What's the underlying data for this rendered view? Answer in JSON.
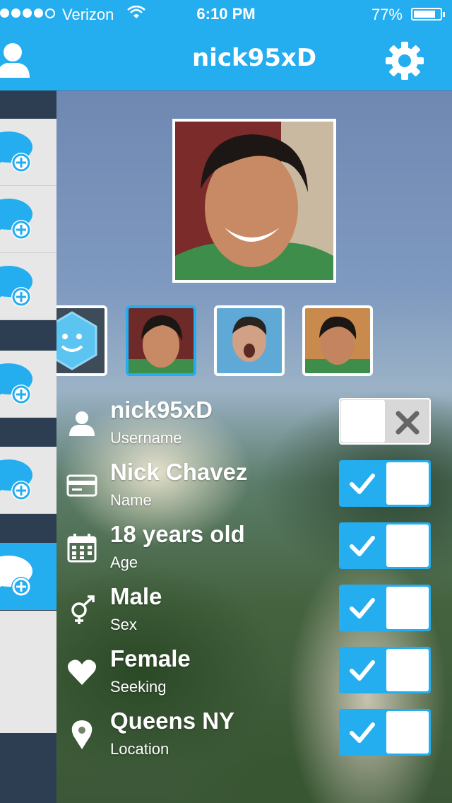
{
  "status_bar": {
    "carrier": "Verizon",
    "time": "6:10 PM",
    "battery": "77%",
    "battery_level": 0.77
  },
  "header": {
    "title": "nick95xD"
  },
  "sidebar": {
    "items": [
      {
        "name": "chat-1"
      },
      {
        "name": "chat-2"
      },
      {
        "name": "chat-3"
      },
      {
        "name": "chat-4"
      },
      {
        "name": "chat-5"
      },
      {
        "name": "chat-6"
      }
    ]
  },
  "profile": {
    "fields": [
      {
        "value": "nick95xD",
        "label": "Username",
        "icon": "person-icon",
        "shared": false
      },
      {
        "value": "Nick Chavez",
        "label": "Name",
        "icon": "card-icon",
        "shared": true
      },
      {
        "value": "18 years old",
        "label": "Age",
        "icon": "calendar-icon",
        "shared": true
      },
      {
        "value": "Male",
        "label": "Sex",
        "icon": "gender-icon",
        "shared": true
      },
      {
        "value": "Female",
        "label": "Seeking",
        "icon": "heart-icon",
        "shared": true
      },
      {
        "value": "Queens NY",
        "label": "Location",
        "icon": "location-pin-icon",
        "shared": true
      }
    ]
  },
  "colors": {
    "accent": "#24adef",
    "sidebar_dark": "#2e3e52",
    "sidebar_light": "#e7e7e7"
  }
}
